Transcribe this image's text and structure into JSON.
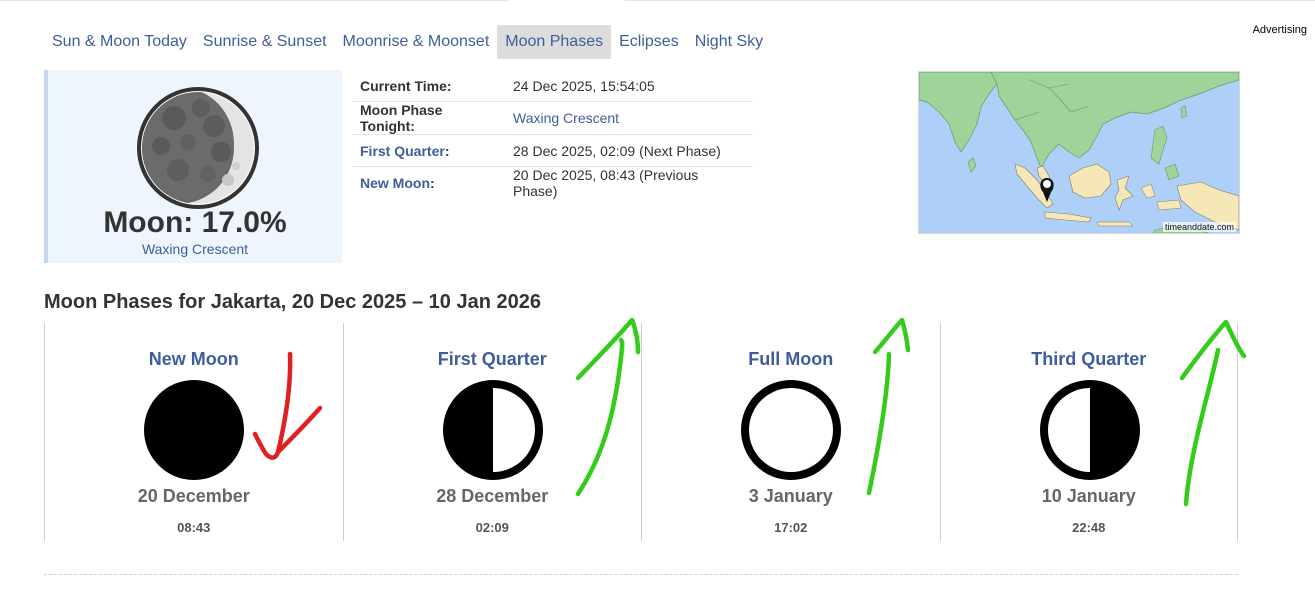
{
  "tabs": [
    {
      "label": "Sun & Moon Today"
    },
    {
      "label": "Sunrise & Sunset"
    },
    {
      "label": "Moonrise & Moonset"
    },
    {
      "label": "Moon Phases",
      "active": true
    },
    {
      "label": "Eclipses"
    },
    {
      "label": "Night Sky"
    }
  ],
  "advertising": "Advertising",
  "moon": {
    "percent_text": "Moon: 17.0%",
    "phase_name": "Waxing Crescent"
  },
  "info": {
    "current_time_label": "Current Time:",
    "current_time_value": "24 Dec 2025, 15:54:05",
    "tonight_label": "Moon Phase Tonight:",
    "tonight_value": "Waxing Crescent",
    "first_quarter_label": "First Quarter",
    "first_quarter_value": "28 Dec 2025, 02:09 (Next Phase)",
    "new_moon_label": "New Moon",
    "new_moon_value": "20 Dec 2025, 08:43 (Previous Phase)"
  },
  "map": {
    "credit": "timeanddate.com"
  },
  "section_title": "Moon Phases for Jakarta, 20 Dec 2025 – 10 Jan 2026",
  "phases": [
    {
      "name": "New Moon",
      "date": "20 December",
      "time": "08:43",
      "icon": "new-moon-icon"
    },
    {
      "name": "First Quarter",
      "date": "28 December",
      "time": "02:09",
      "icon": "first-quarter-icon"
    },
    {
      "name": "Full Moon",
      "date": "3 January",
      "time": "17:02",
      "icon": "full-moon-icon"
    },
    {
      "name": "Third Quarter",
      "date": "10 January",
      "time": "22:48",
      "icon": "third-quarter-icon"
    }
  ],
  "colors": {
    "link": "#3f5d9d",
    "annotation_red": "#e02020",
    "annotation_green": "#33cc1a"
  }
}
